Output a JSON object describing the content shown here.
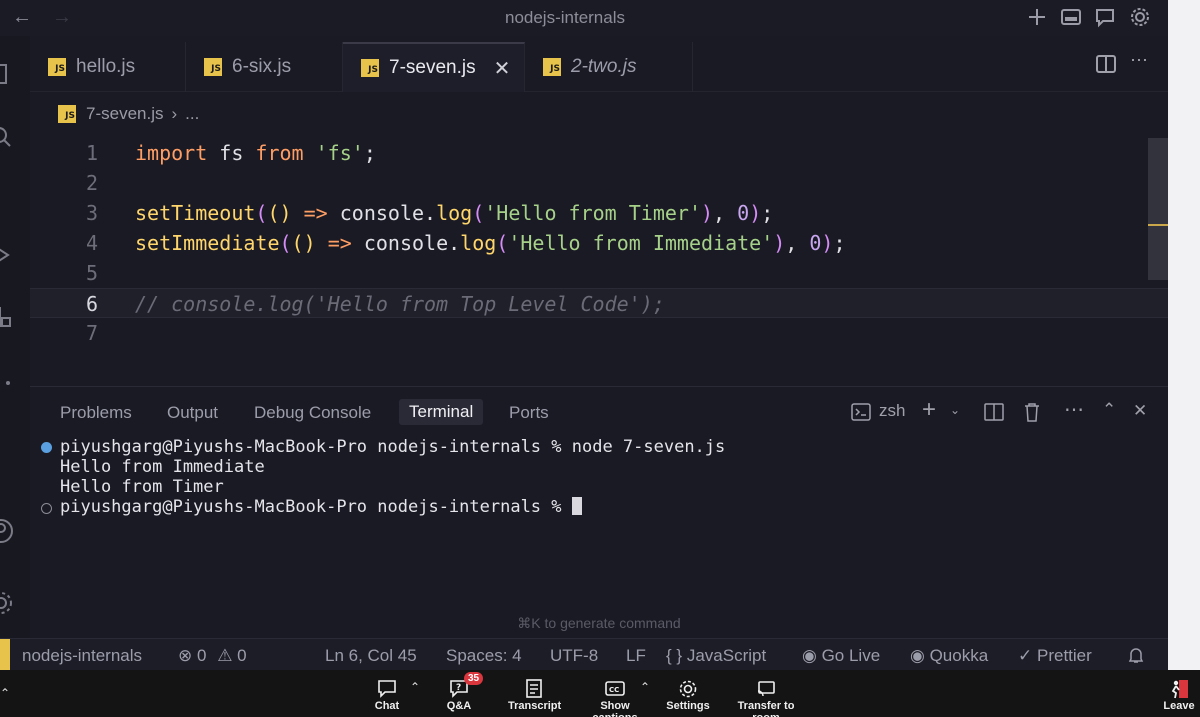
{
  "window": {
    "title": "nodejs-internals"
  },
  "tabs": [
    {
      "label": "hello.js"
    },
    {
      "label": "6-six.js"
    },
    {
      "label": "7-seven.js",
      "active": true
    },
    {
      "label": "2-two.js",
      "italic": true
    }
  ],
  "breadcrumb": {
    "file": "7-seven.js",
    "more": "..."
  },
  "editor": {
    "line_numbers": [
      "1",
      "2",
      "3",
      "4",
      "5",
      "6",
      "7"
    ],
    "current_line": 6
  },
  "panel": {
    "tabs": [
      "Problems",
      "Output",
      "Debug Console",
      "Terminal",
      "Ports"
    ],
    "active_tab": "Terminal",
    "shell": "zsh",
    "terminal_lines": [
      "piyushgarg@Piyushs-MacBook-Pro nodejs-internals % node 7-seven.js",
      "Hello from Immediate",
      "Hello from Timer",
      "piyushgarg@Piyushs-MacBook-Pro nodejs-internals % "
    ],
    "hint": "⌘K to generate command"
  },
  "status": {
    "workspace": "nodejs-internals",
    "errors": "0",
    "warnings": "0",
    "position": "Ln 6, Col 45",
    "spaces": "Spaces: 4",
    "encoding": "UTF-8",
    "eol": "LF",
    "language": "JavaScript",
    "golive": "Go Live",
    "quokka": "Quokka",
    "prettier": "Prettier"
  },
  "meeting": {
    "chat": "Chat",
    "qa": "Q&A",
    "qa_count": "35",
    "transcript": "Transcript",
    "captions": "Show captions",
    "settings": "Settings",
    "transfer": "Transfer to room",
    "leave": "Leave"
  },
  "colors": {
    "accent": "#e8c34b",
    "keyword": "#ff9e64",
    "function": "#ffd66b",
    "string": "#a6d189",
    "number": "#c9a7f0"
  }
}
